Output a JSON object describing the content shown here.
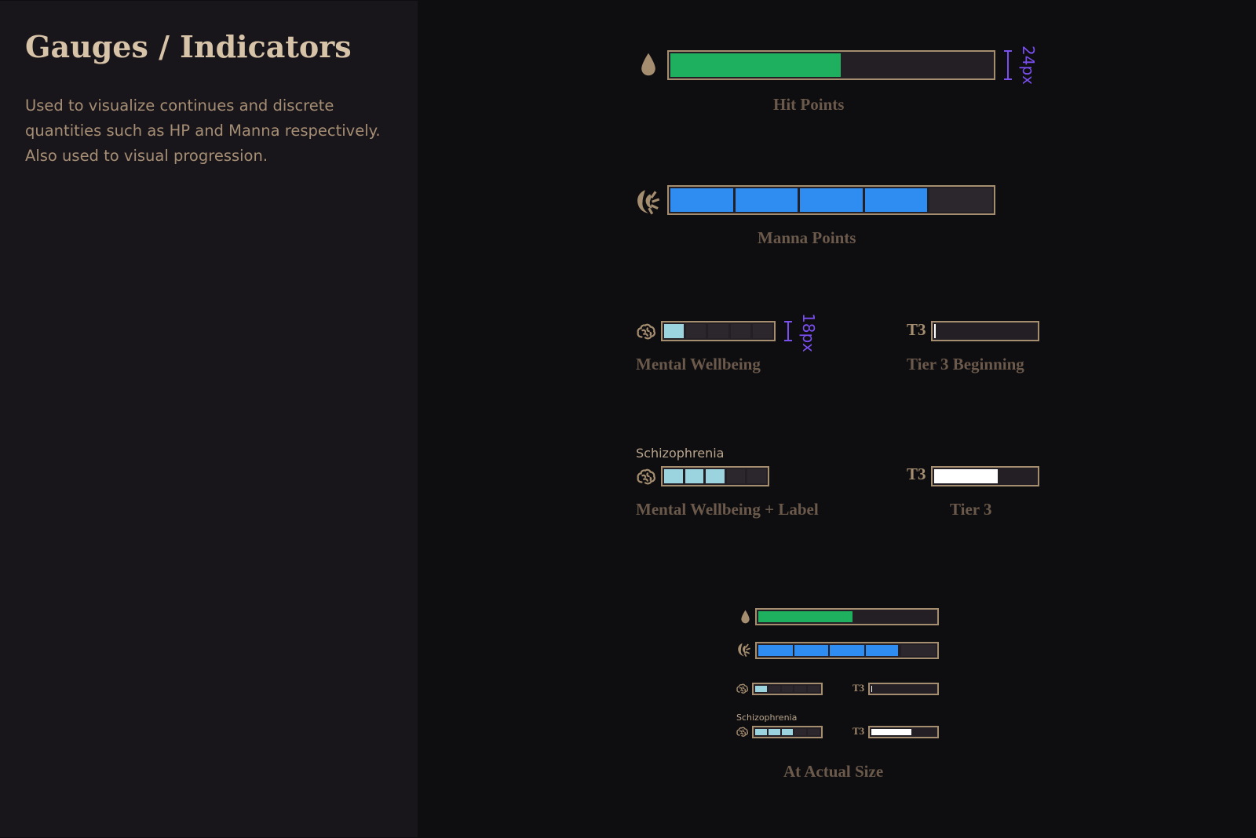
{
  "page": {
    "title": "Gauges / Indicators",
    "description": "Used to visualize continues and discrete quantities such as HP and Manna respectively. Also used to visual progression."
  },
  "colors": {
    "hp_fill": "#1fb05f",
    "manna_fill": "#2f8cf0",
    "mental_fill": "#9bd3de",
    "tier_fill": "#ffffff",
    "frame": "#a58d70",
    "track": "#231f24",
    "annotation": "#7a4ff0"
  },
  "icons": {
    "hp": "drop-icon",
    "manna": "swirl-flame-icon",
    "mental": "brain-icon"
  },
  "gauges": {
    "hit_points": {
      "caption": "Hit Points",
      "fill": 0.53,
      "dimension": "24px"
    },
    "manna_points": {
      "caption": "Manna Points",
      "segments": 5,
      "filled": 4
    },
    "mental_wellbeing": {
      "caption": "Mental Wellbeing",
      "segments": 5,
      "filled": 1,
      "dimension": "18px"
    },
    "tier_beginning": {
      "caption": "Tier 3 Beginning",
      "tier_label": "T3",
      "fill": 0.01
    },
    "mental_label": {
      "caption": "Mental Wellbeing + Label",
      "label": "Schizophrenia",
      "segments": 5,
      "filled": 3
    },
    "tier": {
      "caption": "Tier 3",
      "tier_label": "T3",
      "fill": 0.62
    }
  },
  "actual_size": {
    "caption": "At Actual Size",
    "hp_fill": 0.53,
    "manna_segments": 5,
    "manna_filled": 4,
    "mental_segments": 5,
    "mental_filled": 1,
    "mental_label": "Schizophrenia",
    "mental_label_filled": 3,
    "tier_label": "T3",
    "tier_beginning_fill": 0.01,
    "tier_fill": 0.62,
    "manna_last_partial": 0.95
  }
}
